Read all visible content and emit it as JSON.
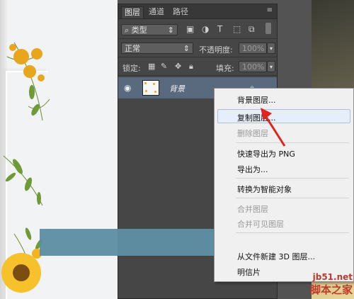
{
  "panel": {
    "tabs": [
      "图层",
      "通道",
      "路径"
    ],
    "filter_kind": "类型",
    "blend_mode": "正常",
    "opacity_label": "不透明度:",
    "opacity_value": "100%",
    "lock_label": "锁定:",
    "fill_label": "填充:",
    "fill_value": "100%"
  },
  "layer": {
    "name": "背景"
  },
  "context_menu": {
    "items": [
      {
        "label": "背景图层...",
        "disabled": false
      },
      {
        "label": "复制图层...",
        "disabled": false,
        "highlighted": true
      },
      {
        "label": "删除图层",
        "disabled": true
      },
      {
        "label": "快速导出为 PNG",
        "disabled": false
      },
      {
        "label": "导出为...",
        "disabled": false
      },
      {
        "label": "转换为智能对象",
        "disabled": false
      },
      {
        "label": "合并图层",
        "disabled": true
      },
      {
        "label": "合并可见图层",
        "disabled": true
      },
      {
        "label": "从文件新建 3D 图层...",
        "disabled": false
      },
      {
        "label": "明信片",
        "disabled": false
      }
    ]
  },
  "watermark": {
    "site": "jb51.net",
    "brand": "脚本之家"
  },
  "colors": {
    "highlight_arrow": "#e0241b",
    "banner": "#5e8fa3",
    "selected_layer": "#5a6a7e"
  }
}
